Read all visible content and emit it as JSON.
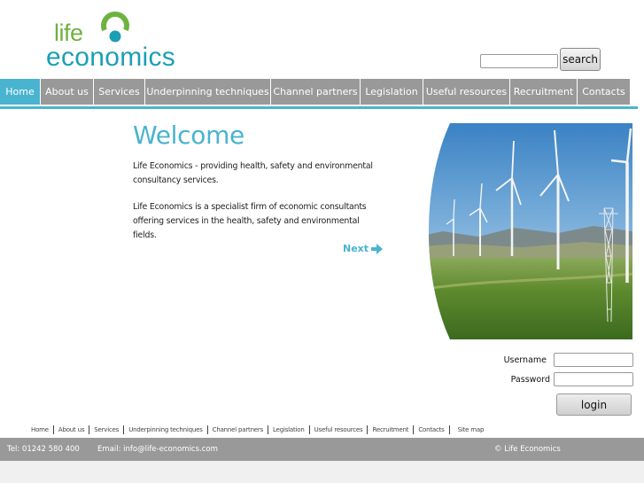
{
  "logo": {
    "line1": "life",
    "line2": "economics",
    "brand_green": "#6db33f",
    "brand_blue": "#1b9fb5"
  },
  "search": {
    "placeholder": "",
    "value": "",
    "button_label": "search"
  },
  "nav": {
    "accent": "#49b4cf",
    "items": [
      {
        "label": "Home",
        "active": true
      },
      {
        "label": "About us"
      },
      {
        "label": "Services"
      },
      {
        "label": "Underpinning techniques"
      },
      {
        "label": "Channel partners"
      },
      {
        "label": "Legislation"
      },
      {
        "label": "Useful resources"
      },
      {
        "label": "Recruitment"
      },
      {
        "label": "Contacts"
      }
    ]
  },
  "main": {
    "title": "Welcome",
    "para1": "Life Economics - providing health, safety and environmental consultancy services.",
    "para2": "Life Economics is a specialist firm of economic consultants offering services in the health, safety and environmental fields.",
    "next_label": "Next",
    "image": "wind-turbines-photo"
  },
  "login": {
    "username_label": "Username",
    "password_label": "Password",
    "username_value": "",
    "password_value": "",
    "button_label": "login"
  },
  "footer_links": [
    "Home",
    "About us",
    "Services",
    "Underpinning techniques",
    "Channel partners",
    "Legislation",
    "Useful resources",
    "Recruitment",
    "Contacts",
    "Site map"
  ],
  "footer": {
    "tel": "Tel: 01242 580 400",
    "email": "Email: info@life-economics.com",
    "copyright": "© Life Economics"
  }
}
